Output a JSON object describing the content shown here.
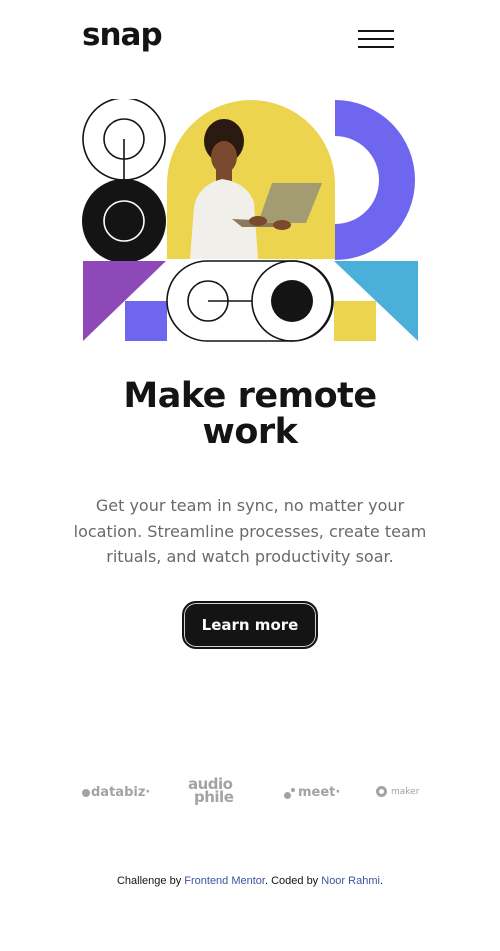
{
  "header": {
    "logo": "snap",
    "menu_icon": "hamburger-menu-icon"
  },
  "hero": {
    "image": "illustration-of-man-with-laptop-and-geometric-shapes",
    "title_line1": "Make remote",
    "title_line2": "work",
    "description": "Get your team in sync, no matter your location. Streamline processes, create team rituals, and watch productivity soar.",
    "cta_label": "Learn more"
  },
  "clients": {
    "databiz": "databiz",
    "databiz_mark": "·",
    "audiophile_line1": "audio",
    "audiophile_line2": "phile",
    "meet": "meet",
    "meet_mark": "·",
    "maker": "maker"
  },
  "footer": {
    "prefix": "Challenge by ",
    "challenge_link": "Frontend Mentor",
    "middle": ". Coded by ",
    "author_link": "Noor Rahmi",
    "suffix": "."
  },
  "colors": {
    "text_dark": "#141414",
    "text_gray": "#696969",
    "logo_gray": "#a3a3a3",
    "link_blue": "#3e52a3",
    "shape_yellow": "#ecd44f",
    "shape_purple": "#6f66ef",
    "shape_violet": "#8d49b8",
    "shape_sky": "#4ab0da"
  }
}
